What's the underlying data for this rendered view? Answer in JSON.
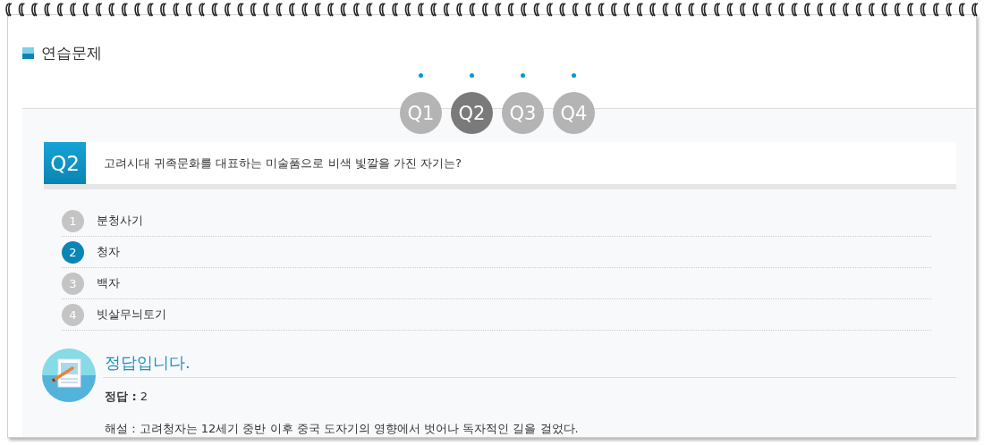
{
  "title": "연습문제",
  "tabs": [
    {
      "label": "Q1",
      "selected": false
    },
    {
      "label": "Q2",
      "selected": true
    },
    {
      "label": "Q3",
      "selected": false
    },
    {
      "label": "Q4",
      "selected": false
    }
  ],
  "question": {
    "number": "Q2",
    "text": "고려시대 귀족문화를 대표하는 미술품으로 비색 빛깔을 가진 자기는?"
  },
  "options": [
    {
      "number": "1",
      "text": "분청사기",
      "selected": false
    },
    {
      "number": "2",
      "text": "청자",
      "selected": true
    },
    {
      "number": "3",
      "text": "백자",
      "selected": false
    },
    {
      "number": "4",
      "text": "빗살무늬토기",
      "selected": false
    }
  ],
  "result": {
    "message": "정답입니다.",
    "answer": "**정답 :** 2",
    "explanation": "해설 : 고려청자는 12세기 중반 이후 중국 도자기의 영향에서 벗어나 독자적인 길을 걸었다."
  }
}
